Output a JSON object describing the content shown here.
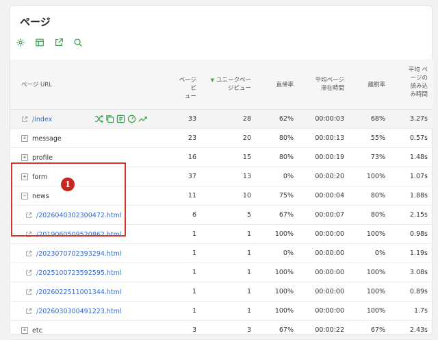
{
  "page": {
    "title": "ページ"
  },
  "toolbar": {
    "icons": [
      "gear-icon",
      "table-icon",
      "export-icon",
      "search-icon"
    ]
  },
  "colors": {
    "accent": "#35a04a",
    "link": "#2d6bd6",
    "callout": "#d8322d"
  },
  "table": {
    "headers": {
      "url": "ページ URL",
      "pv_line1": "ページビ",
      "pv_line2": "ュー",
      "uu_arrow": "▼",
      "uu_line1": "ユニークペー",
      "uu_line2": "ジビュー",
      "bounce": "直帰率",
      "avg_time_line1": "平均ページ",
      "avg_time_line2": "滞在時間",
      "exit": "離脱率",
      "avg_load_line1": "平均 ペ",
      "avg_load_line2": "ージの",
      "avg_load_line3": "読み込",
      "avg_load_line4": "み時間"
    },
    "rows": [
      {
        "url": "/index",
        "pv": "33",
        "uu": "28",
        "bounce": "62%",
        "time": "00:00:03",
        "exit": "68%",
        "load": "3.27s"
      },
      {
        "url": "message",
        "pv": "23",
        "uu": "20",
        "bounce": "80%",
        "time": "00:00:13",
        "exit": "55%",
        "load": "0.57s"
      },
      {
        "url": "profile",
        "pv": "16",
        "uu": "15",
        "bounce": "80%",
        "time": "00:00:19",
        "exit": "73%",
        "load": "1.48s"
      },
      {
        "url": "form",
        "pv": "37",
        "uu": "13",
        "bounce": "0%",
        "time": "00:00:20",
        "exit": "100%",
        "load": "1.07s"
      },
      {
        "url": "news",
        "pv": "11",
        "uu": "10",
        "bounce": "75%",
        "time": "00:00:04",
        "exit": "80%",
        "load": "1.88s"
      },
      {
        "url": "/2026040302300472.html",
        "pv": "6",
        "uu": "5",
        "bounce": "67%",
        "time": "00:00:07",
        "exit": "80%",
        "load": "2.15s"
      },
      {
        "url": "/2019060509520862.html",
        "pv": "1",
        "uu": "1",
        "bounce": "100%",
        "time": "00:00:00",
        "exit": "100%",
        "load": "0.98s"
      },
      {
        "url": "/2023070702393294.html",
        "pv": "1",
        "uu": "1",
        "bounce": "0%",
        "time": "00:00:00",
        "exit": "0%",
        "load": "1.19s"
      },
      {
        "url": "/2025100723592595.html",
        "pv": "1",
        "uu": "1",
        "bounce": "100%",
        "time": "00:00:00",
        "exit": "100%",
        "load": "3.08s"
      },
      {
        "url": "/2026022511001344.html",
        "pv": "1",
        "uu": "1",
        "bounce": "100%",
        "time": "00:00:00",
        "exit": "100%",
        "load": "0.89s"
      },
      {
        "url": "/2026030300491223.html",
        "pv": "1",
        "uu": "1",
        "bounce": "100%",
        "time": "00:00:00",
        "exit": "100%",
        "load": "1.7s"
      },
      {
        "url": "etc",
        "pv": "3",
        "uu": "3",
        "bounce": "67%",
        "time": "00:00:22",
        "exit": "67%",
        "load": "2.43s"
      }
    ]
  },
  "expanders": {
    "plus": "+",
    "minus": "−"
  },
  "annotation": {
    "badge": "1"
  }
}
